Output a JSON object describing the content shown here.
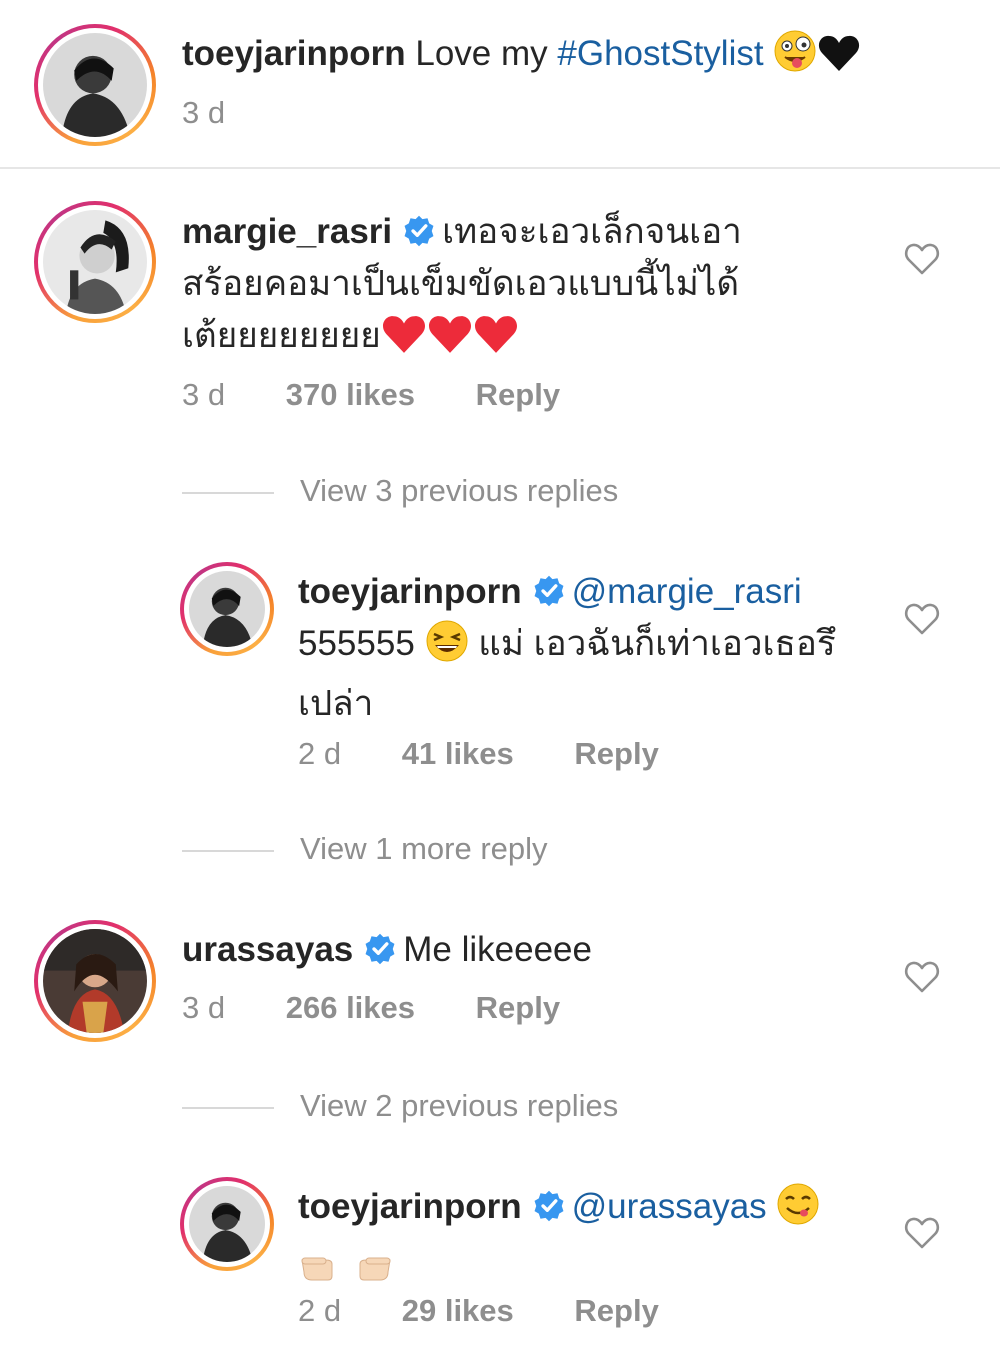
{
  "post_caption": {
    "username": "toeyjarinporn",
    "text": "Love my",
    "hashtag": "#GhostStylist",
    "time": "3 d"
  },
  "comments": [
    {
      "username": "margie_rasri",
      "verified": true,
      "lines": [
        "เทอจะเอวเล็กจนเอา",
        "สร้อยคอมาเป็นเข็มขัดเอวแบบนี้ไม่ได้",
        "เต้ยยยยยยยย"
      ],
      "time": "3 d",
      "likes": "370 likes",
      "reply_label": "Reply",
      "view_replies": "View 3 previous replies",
      "reply": {
        "username": "toeyjarinporn",
        "verified": true,
        "mention": "@margie_rasri",
        "line2_prefix": "555555",
        "line2_suffix": "แม่ เอวฉันก็เท่าเอวเธอรึ",
        "line3": "เปล่า",
        "time": "2 d",
        "likes": "41 likes",
        "reply_label": "Reply"
      },
      "view_more": "View 1 more reply"
    },
    {
      "username": "urassayas",
      "verified": true,
      "text": "Me likeeeee",
      "time": "3 d",
      "likes": "266 likes",
      "reply_label": "Reply",
      "view_replies": "View 2 previous replies",
      "reply": {
        "username": "toeyjarinporn",
        "verified": true,
        "mention": "@urassayas",
        "time": "2 d",
        "likes": "29 likes",
        "reply_label": "Reply"
      }
    }
  ],
  "colors": {
    "link": "#1a5fa0",
    "meta": "#8e8e8e",
    "verified": "#3897f0",
    "heart_red": "#ed2b3a"
  }
}
